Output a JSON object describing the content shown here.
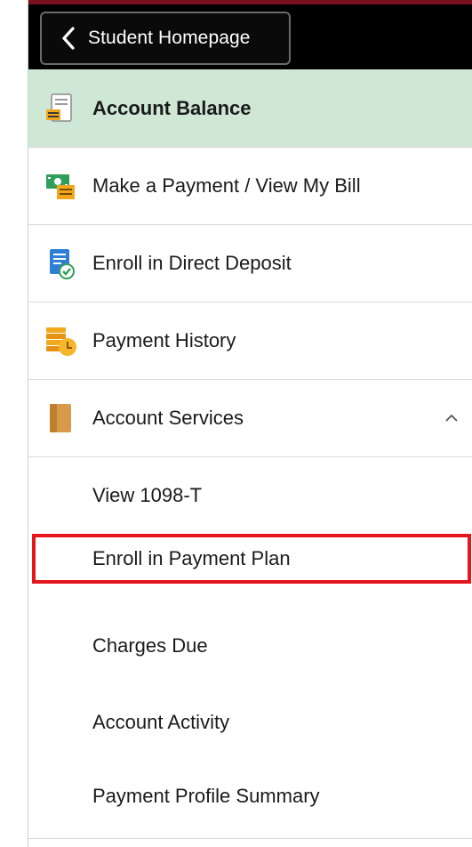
{
  "header": {
    "back_label": "Student Homepage"
  },
  "menu": {
    "items": [
      {
        "label": "Account Balance",
        "icon": "balance-document-icon",
        "active": true
      },
      {
        "label": "Make a Payment / View My Bill",
        "icon": "payment-bill-icon",
        "active": false
      },
      {
        "label": "Enroll in Direct Deposit",
        "icon": "direct-deposit-icon",
        "active": false
      },
      {
        "label": "Payment History",
        "icon": "payment-history-icon",
        "active": false
      },
      {
        "label": "Account Services",
        "icon": "account-services-icon",
        "active": false,
        "expanded": true
      }
    ],
    "sub_items": [
      {
        "label": "View 1098-T"
      },
      {
        "label": "Enroll in Payment Plan",
        "highlighted": true
      },
      {
        "label": "Charges Due"
      },
      {
        "label": "Account Activity"
      },
      {
        "label": "Payment Profile Summary"
      }
    ]
  },
  "colors": {
    "header_bg": "#000000",
    "active_bg": "#cfe8d6",
    "highlight_border": "#e4151c"
  }
}
